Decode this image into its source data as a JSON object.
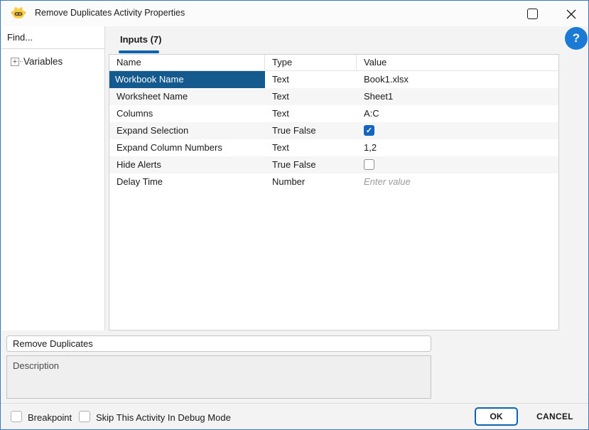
{
  "window": {
    "title": "Remove Duplicates Activity Properties"
  },
  "sidebar": {
    "find_label": "Find...",
    "tree": [
      {
        "label": "Variables",
        "expander": "+"
      }
    ]
  },
  "tabs": {
    "inputs_label": "Inputs (7)"
  },
  "help": {
    "glyph": "?"
  },
  "table": {
    "headers": [
      "Name",
      "Type",
      "Value"
    ],
    "rows": [
      {
        "name": "Workbook Name",
        "type": "Text",
        "value_kind": "text",
        "value": "Book1.xlsx",
        "selected": true
      },
      {
        "name": "Worksheet Name",
        "type": "Text",
        "value_kind": "text",
        "value": "Sheet1"
      },
      {
        "name": "Columns",
        "type": "Text",
        "value_kind": "text",
        "value": "A:C"
      },
      {
        "name": "Expand Selection",
        "type": "True False",
        "value_kind": "checkbox",
        "checked": true
      },
      {
        "name": "Expand Column Numbers",
        "type": "Text",
        "value_kind": "text",
        "value": "1,2"
      },
      {
        "name": "Hide Alerts",
        "type": "True False",
        "value_kind": "checkbox",
        "checked": false
      },
      {
        "name": "Delay Time",
        "type": "Number",
        "value_kind": "placeholder",
        "placeholder": "Enter value"
      }
    ]
  },
  "activity": {
    "name_value": "Remove Duplicates",
    "description_placeholder": "Description"
  },
  "footer": {
    "breakpoint_label": "Breakpoint",
    "skip_label": "Skip This Activity In Debug Mode",
    "ok_label": "OK",
    "cancel_label": "CANCEL"
  },
  "colors": {
    "accent_blue": "#0f64b0",
    "selected_row": "#155a8e",
    "checkbox_checked": "#1566c0",
    "help_blue": "#1a7ad4",
    "check_glyph": "✓"
  }
}
